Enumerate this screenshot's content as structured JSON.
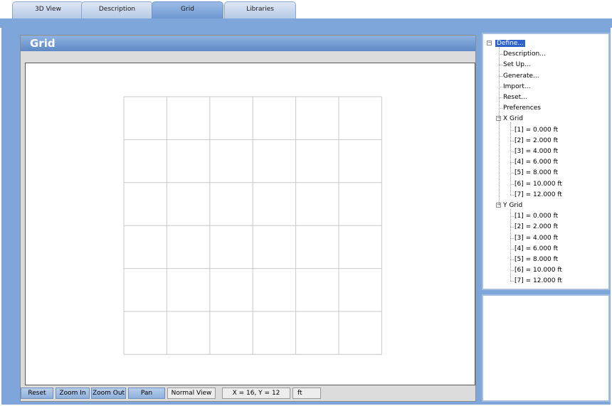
{
  "tabs": [
    {
      "label": "3D View",
      "active": false
    },
    {
      "label": "Description",
      "active": false
    },
    {
      "label": "Grid",
      "active": true
    },
    {
      "label": "Libraries",
      "active": false
    }
  ],
  "panel": {
    "title": "Grid"
  },
  "toolbar": {
    "reset": "Reset",
    "zoom_in": "Zoom In",
    "zoom_out": "Zoom Out",
    "pan": "Pan",
    "view_mode": "Normal View",
    "coords": "X = 16, Y = 12",
    "units": "ft"
  },
  "tree": {
    "root": "Define...",
    "menu": [
      "Description...",
      "Set Up...",
      "Generate...",
      "Import...",
      "Reset...",
      "Preferences"
    ],
    "x_grid": {
      "label": "X Grid",
      "items": [
        "[1] = 0.000 ft",
        "[2] = 2.000 ft",
        "[3] = 4.000 ft",
        "[4] = 6.000 ft",
        "[5] = 8.000 ft",
        "[6] = 10.000 ft",
        "[7] = 12.000 ft"
      ]
    },
    "y_grid": {
      "label": "Y Grid",
      "items": [
        "[1] = 0.000 ft",
        "[2] = 2.000 ft",
        "[3] = 4.000 ft",
        "[4] = 6.000 ft",
        "[5] = 8.000 ft",
        "[6] = 10.000 ft",
        "[7] = 12.000 ft"
      ]
    }
  },
  "grid": {
    "x_lines_ft": [
      0,
      2,
      4,
      6,
      8,
      10,
      12
    ],
    "y_lines_ft": [
      0,
      2,
      4,
      6,
      8,
      10,
      12
    ]
  },
  "colors": {
    "accent": "#7ea6db",
    "selection": "#2f62c6",
    "grid_line": "#c8c8c8"
  }
}
